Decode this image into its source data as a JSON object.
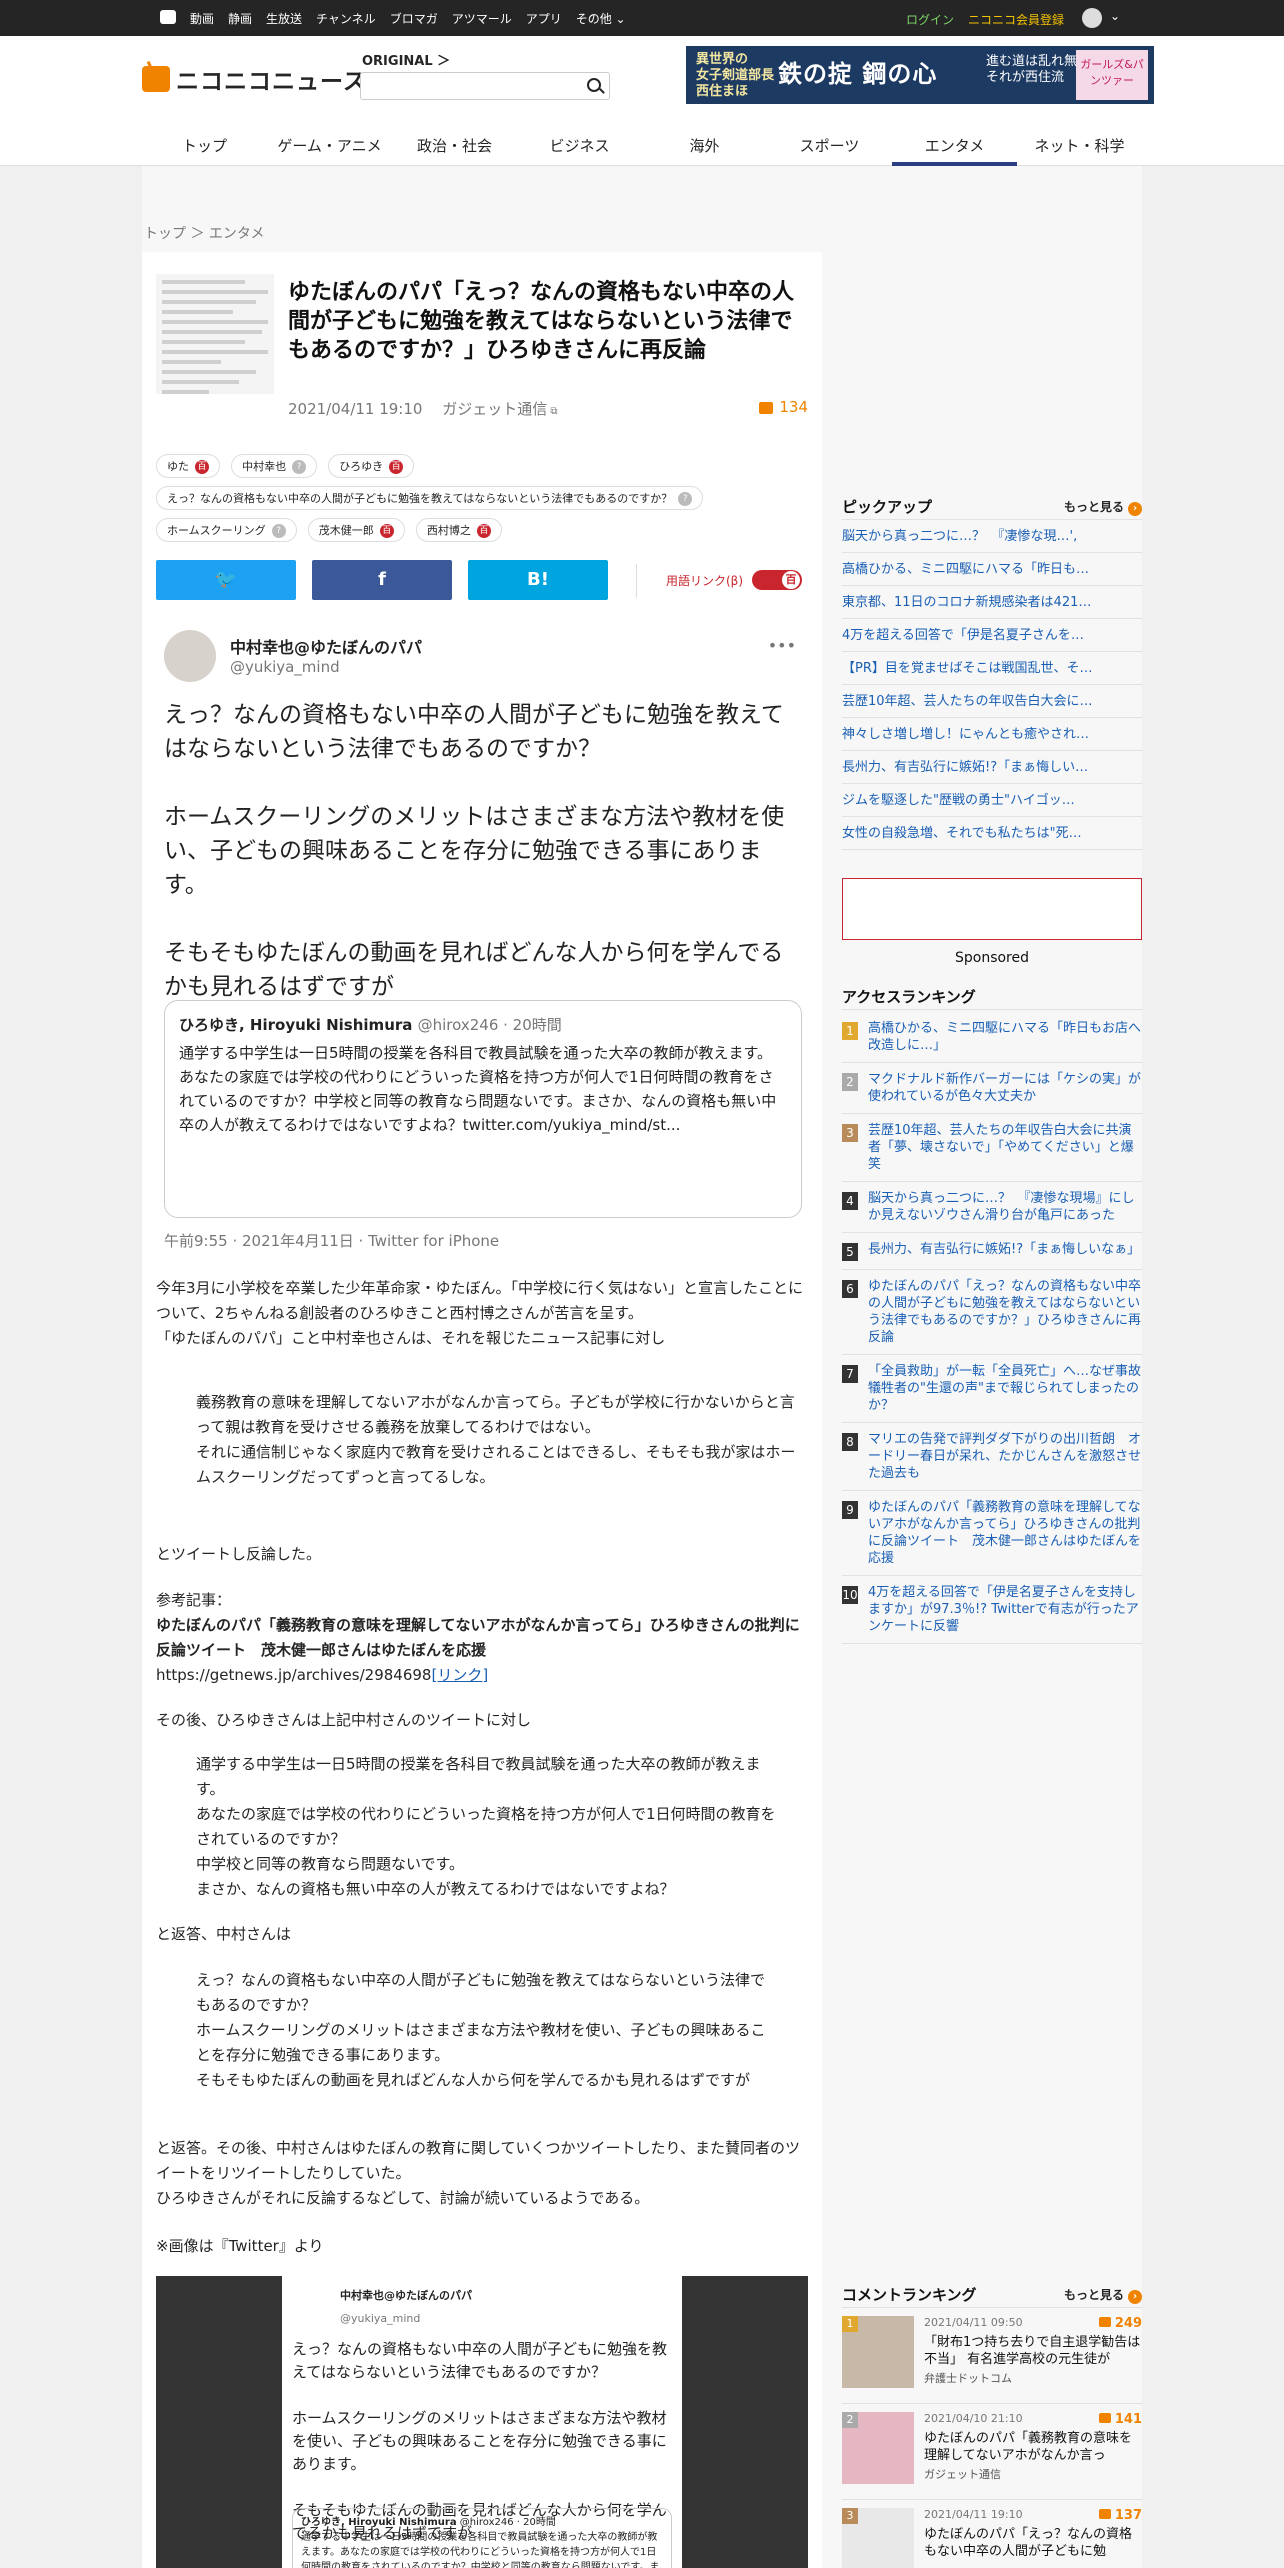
{
  "topbar": {
    "nav": [
      "動画",
      "静画",
      "生放送",
      "チャンネル",
      "ブロマガ",
      "アツマール",
      "アプリ",
      "その他 ⌄"
    ],
    "login": "ログイン",
    "register": "ニコニコ会員登録"
  },
  "header": {
    "logo_text": "ニコニコニュース",
    "original_label": "ORIGINAL ＞",
    "search_placeholder": "",
    "banner": {
      "l1": "異世界の",
      "l2": "女子剣道部長",
      "l3": "西住まほ",
      "big": "鉄の掟 鋼の心",
      "r1": "進む道は乱れ無し",
      "r2": "それが西住流",
      "badge": "ガールズ&パンツァー"
    },
    "nav": [
      "トップ",
      "ゲーム・アニメ",
      "政治・社会",
      "ビジネス",
      "海外",
      "スポーツ",
      "エンタメ",
      "ネット・科学"
    ],
    "active_nav": "エンタメ"
  },
  "breadcrumb": "トップ ＞ エンタメ",
  "article": {
    "title": "ゆたぼんのパパ「えっ？なんの資格もない中卒の人間が子どもに勉強を教えてはならないという法律でもあるのですか？」ひろゆきさんに再反論",
    "date": "2021/04/11 19:10",
    "source": "ガジェット通信",
    "comment_count": "134",
    "tags": [
      {
        "label": "ゆた",
        "badge": "百"
      },
      {
        "label": "中村幸也",
        "badge": "?"
      },
      {
        "label": "ひろゆき",
        "badge": "百"
      },
      {
        "label": "えっ？なんの資格もない中卒の人間が子どもに勉強を教えてはならないという法律でもあるのですか？",
        "badge": "?"
      },
      {
        "label": "ホームスクーリング",
        "badge": "?"
      },
      {
        "label": "茂木健一郎",
        "badge": "百"
      },
      {
        "label": "西村博之",
        "badge": "百"
      }
    ],
    "share": {
      "twitter": "🐦",
      "facebook": "f",
      "hatena": "B!",
      "yougo": "用語リンク(β)",
      "toggle": "百"
    },
    "tweet": {
      "name": "中村幸也@ゆたぼんのパパ",
      "handle": "@yukiya_mind",
      "p1": "えっ？なんの資格もない中卒の人間が子どもに勉強を教えてはならないという法律でもあるのですか？",
      "p2": "ホームスクーリングのメリットはさまざまな方法や教材を使い、子どもの興味あることを存分に勉強できる事にあります。",
      "p3": "そもそもゆたぼんの動画を見ればどんな人から何を学んでるかも見れるはずですが",
      "quote_name": "ひろゆき, Hiroyuki Nishimura",
      "quote_meta": "@hirox246 · 20時間",
      "quote_text": "通学する中学生は一日5時間の授業を各科目で教員試験を通った大卒の教師が教えます。あなたの家庭では学校の代わりにどういった資格を持つ方が何人で1日何時間の教育をされているのですか？中学校と同等の教育なら問題ないです。まさか、なんの資格も無い中卒の人が教えてるわけではないですよね？twitter.com/yukiya_mind/st...",
      "time": "午前9:55 · 2021年4月11日 · Twitter for iPhone"
    },
    "para1": "今年3月に小学校を卒業した少年革命家・ゆたぼん。「中学校に行く気はない」と宣言したことについて、2ちゃんねる創設者のひろゆきこと西村博之さんが苦言を呈す。",
    "para2": "「ゆたぼんのパパ」こと中村幸也さんは、それを報じたニュース記事に対し",
    "quote1": "義務教育の意味を理解してないアホがなんか言ってら。子どもが学校に行かないからと言って親は教育を受けさせる義務を放棄してるわけではない。",
    "quote1b": "それに通信制じゃなく家庭内で教育を受けされることはできるし、そもそも我が家はホームスクーリングだってずっと言ってるしな。",
    "para3": "とツイートし反論した。",
    "ref_label": "参考記事：",
    "ref_title": "ゆたぼんのパパ「義務教育の意味を理解してないアホがなんか言ってら」ひろゆきさんの批判に反論ツイート　茂木健一郎さんはゆたぼんを応援",
    "ref_url": "https://getnews.jp/archives/2984698",
    "ref_link": "[リンク]",
    "para4": "その後、ひろゆきさんは上記中村さんのツイートに対し",
    "quote2": [
      "通学する中学生は一日5時間の授業を各科目で教員試験を通った大卒の教師が教えます。",
      "あなたの家庭では学校の代わりにどういった資格を持つ方が何人で1日何時間の教育をされているのですか？",
      "中学校と同等の教育なら問題ないです。",
      "まさか、なんの資格も無い中卒の人が教えてるわけではないですよね？"
    ],
    "para5": "と返答、中村さんは",
    "quote3": [
      "えっ？なんの資格もない中卒の人間が子どもに勉強を教えてはならないという法律でもあるのですか？",
      "ホームスクーリングのメリットはさまざまな方法や教材を使い、子どもの興味あることを存分に勉強できる事にあります。",
      "そもそもゆたぼんの動画を見ればどんな人から何を学んでるかも見れるはずですが"
    ],
    "para6": "と返答。その後、中村さんはゆたぼんの教育に関していくつかツイートしたり、また賛同者のツイートをリツイートしたりしていた。",
    "para6b": "ひろゆきさんがそれに反論するなどして、討論が続いているようである。",
    "note": "※画像は『Twitter』より"
  },
  "sidebar": {
    "pickup_title": "ピックアップ",
    "more": "もっと見る",
    "pickup": [
      "脳天から真っ二つに…？　『凄惨な現…',",
      "高橋ひかる、ミニ四駆にハマる「昨日も…",
      "東京都、11日のコロナ新規感染者は421…",
      "4万を超える回答で「伊是名夏子さんを…",
      "【PR】目を覚ませばそこは戦国乱世、そ…",
      "芸歴10年超、芸人たちの年収告白大会に…",
      "神々しさ増し増し！にゃんとも癒やされ…",
      "長州力、有吉弘行に嫉妬!?「まぁ悔しい…",
      "ジムを駆逐した\"歴戦の勇士\"ハイゴッ…",
      "女性の自殺急増、それでも私たちは\"死…"
    ],
    "sponsored": "Sponsored",
    "access_title": "アクセスランキング",
    "access": [
      "高橋ひかる、ミニ四駆にハマる「昨日もお店へ改造しに…」",
      "マクドナルド新作バーガーには「ケシの実」が使われているが色々大丈夫か",
      "芸歴10年超、芸人たちの年収告白大会に共演者「夢、壊さないで」「やめてください」と爆笑",
      "脳天から真っ二つに…？　『凄惨な現場』にしか見えないゾウさん滑り台が亀戸にあった",
      "長州力、有吉弘行に嫉妬!?「まぁ悔しいなぁ」",
      "ゆたぼんのパパ「えっ？なんの資格もない中卒の人間が子どもに勉強を教えてはならないという法律でもあるのですか？」ひろゆきさんに再反論",
      "「全員救助」が一転「全員死亡」へ…なぜ事故犠牲者の\"生還の声\"まで報じられてしまったのか？",
      "マリエの告発で評判ダダ下がりの出川哲朗　オードリー春日が呆れ、たかじんさんを激怒させた過去も",
      "ゆたぼんのパパ「義務教育の意味を理解してないアホがなんか言ってら」ひろゆきさんの批判に反論ツイート　茂木健一郎さんはゆたぼんを応援",
      "4万を超える回答で「伊是名夏子さんを支持しますか」が97.3％!? Twitterで有志が行ったアンケートに反響"
    ],
    "comment_title": "コメントランキング",
    "comments": [
      {
        "num": "1",
        "date": "2021/04/11 09:50",
        "count": "249",
        "title": "「財布1つ持ち去りで自主退学勧告は不当」 有名進学高校の元生徒が",
        "source": "弁護士ドットコム"
      },
      {
        "num": "2",
        "date": "2021/04/10 21:10",
        "count": "141",
        "title": "ゆたぼんのパパ「義務教育の意味を理解してないアホがなんか言っ",
        "source": "ガジェット通信"
      },
      {
        "num": "3",
        "date": "2021/04/11 19:10",
        "count": "137",
        "title": "ゆたぼんのパパ「えっ？なんの資格もない中卒の人間が子どもに勉",
        "source": ""
      }
    ]
  },
  "colors": {
    "accent": "#f08300",
    "nav_active": "#2c3e82",
    "rank1": "#e0a82e",
    "rank2": "#aaaaaa",
    "rank3": "#b98b5a",
    "rank_other": "#333333"
  }
}
